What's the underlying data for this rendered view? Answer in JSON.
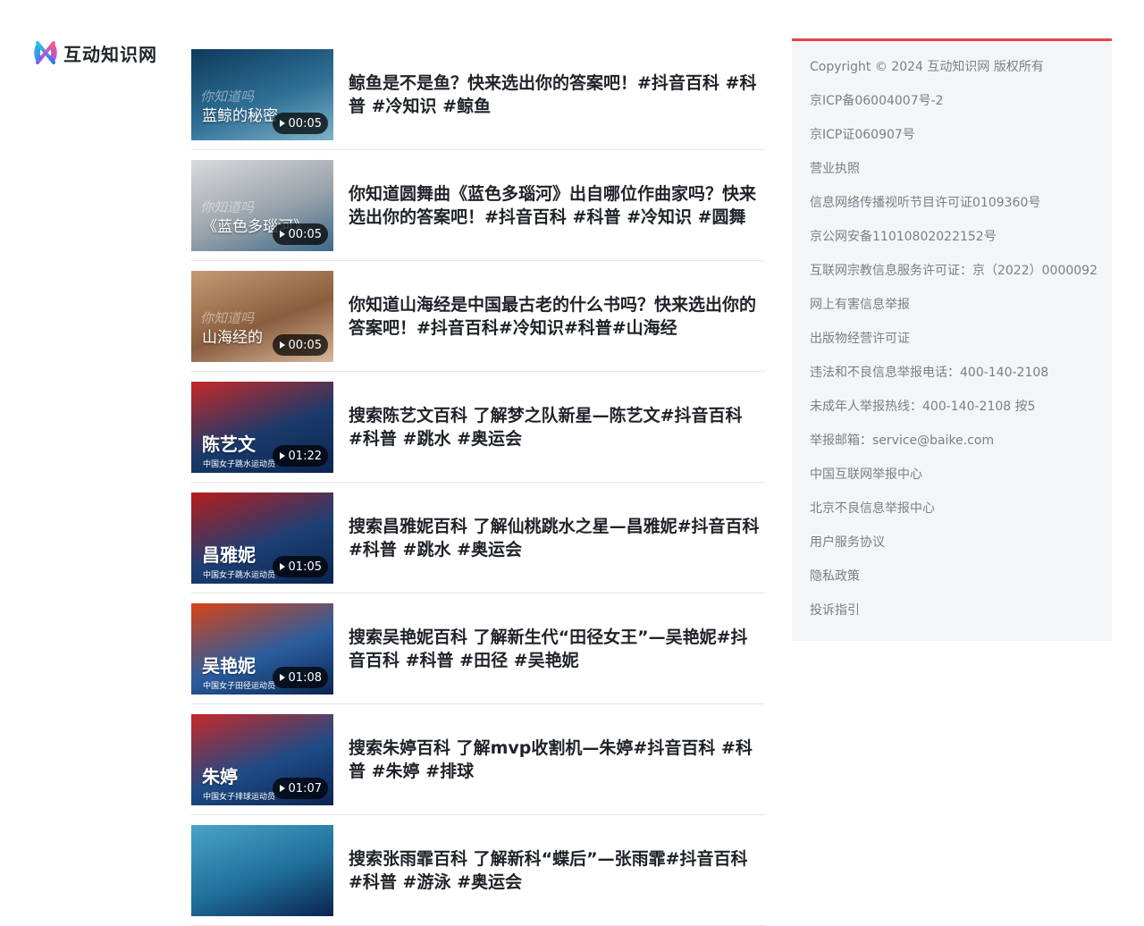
{
  "logo": {
    "text": "互动知识网"
  },
  "videos": [
    {
      "title": "鲸鱼是不是鱼？快来选出你的答案吧！#抖音百科 #科普 #冷知识 #鲸鱼",
      "duration": "00:05",
      "thumb_text": "蓝鲸的秘密",
      "thumb_watermark": "你知道吗",
      "thumb_caption": "",
      "thumb_colors": [
        "#0d3a5c",
        "#2f6f95",
        "#7fb3c9"
      ]
    },
    {
      "title": "你知道圆舞曲《蓝色多瑙河》出自哪位作曲家吗？快来选出你的答案吧！#抖音百科 #科普 #冷知识 #圆舞曲",
      "duration": "00:05",
      "thumb_text": "《蓝色多瑙河》",
      "thumb_watermark": "你知道吗",
      "thumb_caption": "",
      "thumb_colors": [
        "#d9dadb",
        "#9aa3ab",
        "#3c6a8a"
      ]
    },
    {
      "title": "你知道山海经是中国最古老的什么书吗？快来选出你的答案吧！#抖音百科#冷知识#科普#山海经",
      "duration": "00:05",
      "thumb_text": "山海经的",
      "thumb_watermark": "你知道吗",
      "thumb_caption": "",
      "thumb_colors": [
        "#c69a74",
        "#8a5d3e",
        "#d7b89a"
      ]
    },
    {
      "title": "搜索陈艺文百科 了解梦之队新星—陈艺文#抖音百科 #科普 #跳水 #奥运会",
      "duration": "01:22",
      "thumb_text": "陈艺文",
      "thumb_watermark": "",
      "thumb_caption": "中国女子跳水运动员",
      "thumb_colors": [
        "#c62828",
        "#1a3a6b",
        "#0b2450"
      ]
    },
    {
      "title": "搜索昌雅妮百科 了解仙桃跳水之星—昌雅妮#抖音百科 #科普 #跳水 #奥运会",
      "duration": "01:05",
      "thumb_text": "昌雅妮",
      "thumb_watermark": "",
      "thumb_caption": "中国女子跳水运动员",
      "thumb_colors": [
        "#b71c1c",
        "#1d3f74",
        "#0b2450"
      ]
    },
    {
      "title": "搜索吴艳妮百科 了解新生代“田径女王”—吴艳妮#抖音百科 #科普 #田径 #吴艳妮",
      "duration": "01:08",
      "thumb_text": "吴艳妮",
      "thumb_watermark": "",
      "thumb_caption": "中国女子田径运动员",
      "thumb_colors": [
        "#d84315",
        "#2a5d9f",
        "#0b2450"
      ]
    },
    {
      "title": "搜索朱婷百科 了解mvp收割机—朱婷#抖音百科 #科普 #朱婷 #排球",
      "duration": "01:07",
      "thumb_text": "朱婷",
      "thumb_watermark": "",
      "thumb_caption": "中国女子排球运动员",
      "thumb_colors": [
        "#c62828",
        "#1e4b86",
        "#0b2450"
      ]
    },
    {
      "title": "搜索张雨霏百科 了解新科“蝶后”—张雨霏#抖音百科 #科普 #游泳 #奥运会",
      "duration": "",
      "thumb_text": "",
      "thumb_watermark": "",
      "thumb_caption": "",
      "thumb_colors": [
        "#4aa3c8",
        "#1f6f9a",
        "#0b2450"
      ]
    }
  ],
  "footer": {
    "links": [
      "Copyright © 2024 互动知识网 版权所有",
      "京ICP备06004007号-2",
      "京ICP证060907号",
      "营业执照",
      "信息网络传播视听节目许可证0109360号",
      "京公网安备11010802022152号",
      "互联网宗教信息服务许可证：京（2022）0000092",
      "网上有害信息举报",
      "出版物经营许可证",
      "违法和不良信息举报电话：400-140-2108",
      "未成年人举报热线：400-140-2108 按5",
      "举报邮箱：service@baike.com",
      "中国互联网举报中心",
      "北京不良信息举报中心",
      "用户服务协议",
      "隐私政策",
      "投诉指引"
    ],
    "accent_color": "#e54545"
  }
}
